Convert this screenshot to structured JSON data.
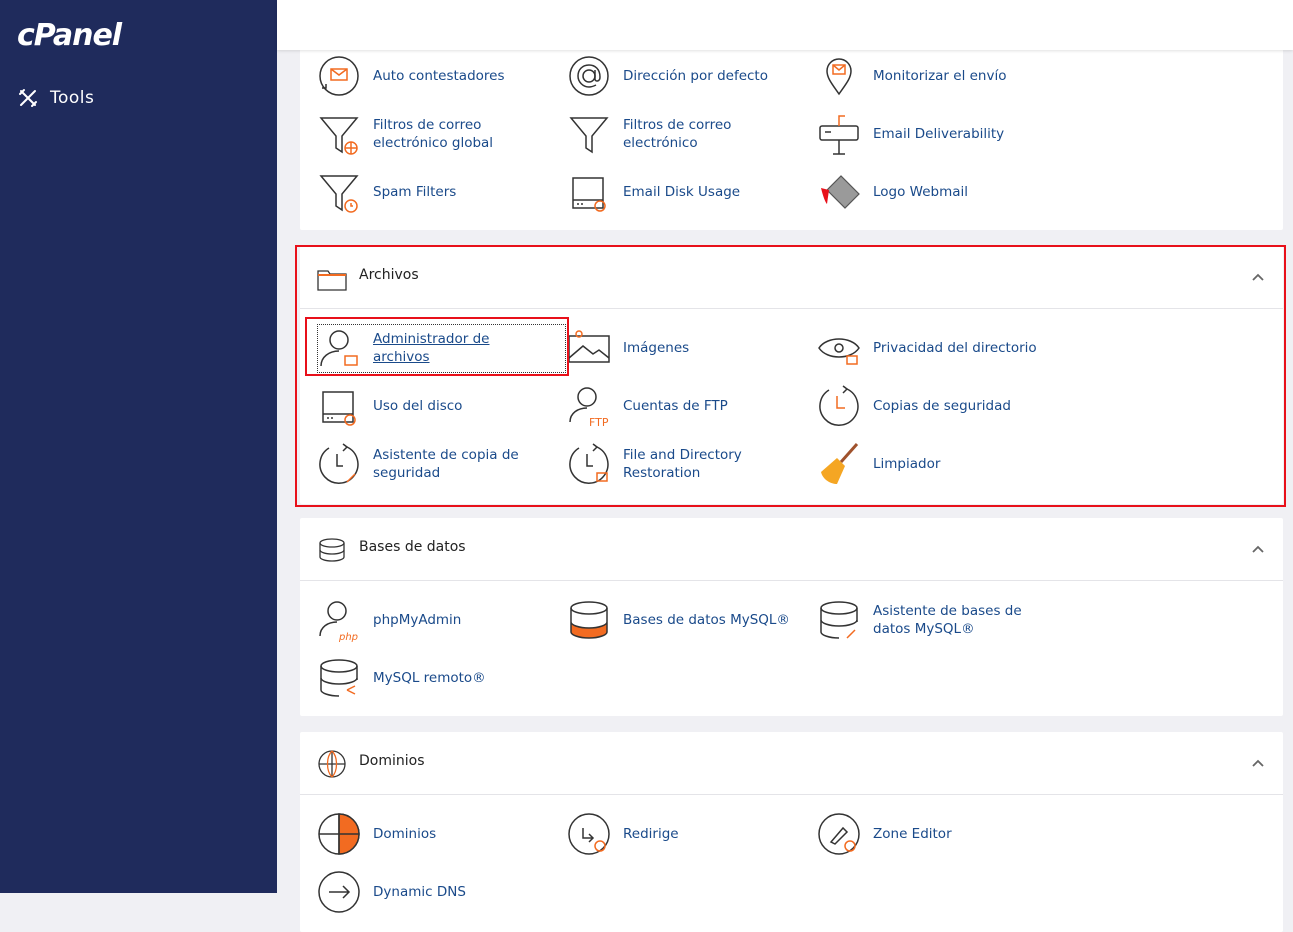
{
  "sidebar": {
    "logo": "cPanel",
    "tools_label": "Tools"
  },
  "email_rows": [
    [
      "Auto contestadores",
      "Dirección por defecto",
      "Monitorizar el envío"
    ],
    [
      "Filtros de correo electrónico global",
      "Filtros de correo electrónico",
      "Email Deliverability"
    ],
    [
      "Spam Filters",
      "Email Disk Usage",
      "Logo Webmail"
    ]
  ],
  "archivos": {
    "title": "Archivos",
    "items": [
      "Administrador de archivos",
      "Imágenes",
      "Privacidad del directorio",
      "Uso del disco",
      "Cuentas de FTP",
      "Copias de seguridad",
      "Asistente de copia de seguridad",
      "File and Directory Restoration",
      "Limpiador"
    ]
  },
  "bases": {
    "title": "Bases de datos",
    "items": [
      "phpMyAdmin",
      "Bases de datos MySQL®",
      "Asistente de bases de datos MySQL®",
      "MySQL remoto®"
    ]
  },
  "dominios": {
    "title": "Dominios",
    "items": [
      "Dominios",
      "Redirige",
      "Zone Editor",
      "Dynamic DNS"
    ]
  },
  "colors": {
    "sidebar": "#1f2b5c",
    "accent": "#f26b21",
    "link": "#1a4a8a",
    "highlight": "#e8101a"
  }
}
